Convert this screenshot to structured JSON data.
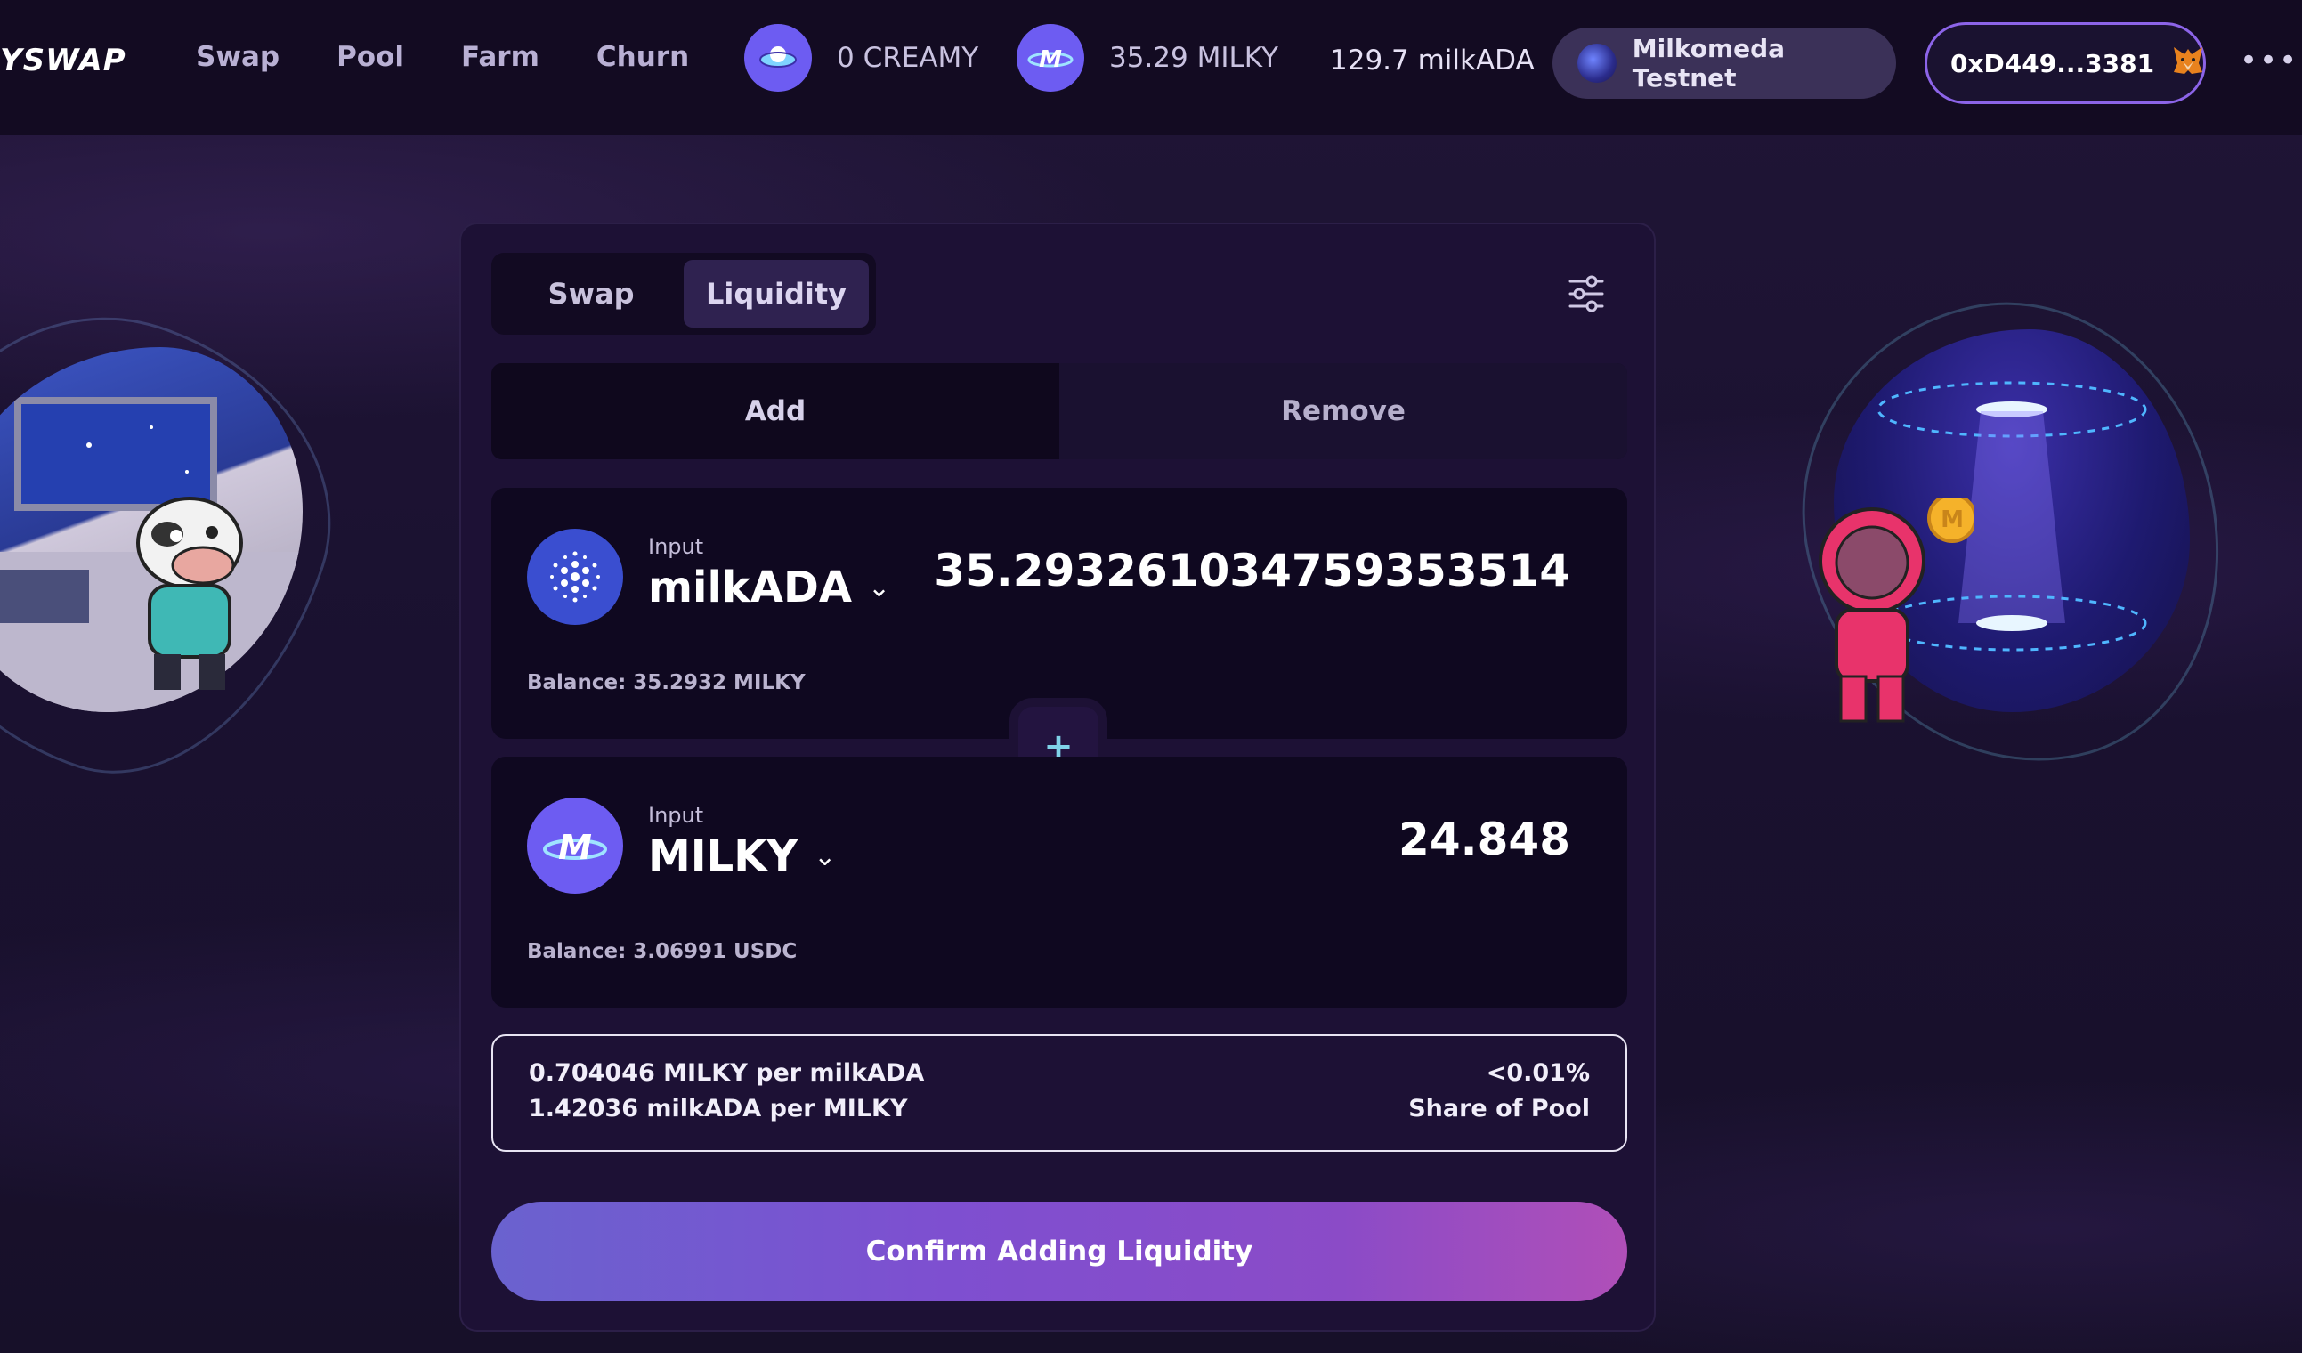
{
  "header": {
    "logo_text": "YSWAP",
    "nav": [
      "Swap",
      "Pool",
      "Farm",
      "Churn"
    ],
    "stats": {
      "creamy": "0 CREAMY",
      "milky": "35.29 MILKY",
      "milkada": "129.7 milkADA"
    },
    "network": "Milkomeda Testnet",
    "wallet": "0xD449...3381"
  },
  "card": {
    "tabs": [
      "Swap",
      "Liquidity"
    ],
    "active_tab": "Liquidity",
    "modes": [
      "Add",
      "Remove"
    ],
    "active_mode": "Add",
    "input_a": {
      "label": "Input",
      "token": "milkADA",
      "amount": "35.293261034759353514",
      "balance": "Balance: 35.2932 MILKY"
    },
    "input_b": {
      "label": "Input",
      "token": "MILKY",
      "amount": "24.848",
      "balance": "Balance: 3.06991 USDC"
    },
    "prices": {
      "line1": "0.704046 MILKY per milkADA",
      "line2": "1.42036 milkADA per MILKY",
      "share_value": "<0.01%",
      "share_label": "Share of Pool"
    },
    "confirm_label": "Confirm Adding Liquidity"
  },
  "colors": {
    "accent": "#6d5cf2",
    "background": "#1c1230",
    "card": "#1d1135"
  },
  "icons": [
    "creamy-token-icon",
    "milky-token-icon",
    "network-icon",
    "metamask-fox-icon",
    "more-icon",
    "settings-sliders-icon",
    "cardano-icon",
    "plus-icon",
    "chevron-down-icon"
  ]
}
